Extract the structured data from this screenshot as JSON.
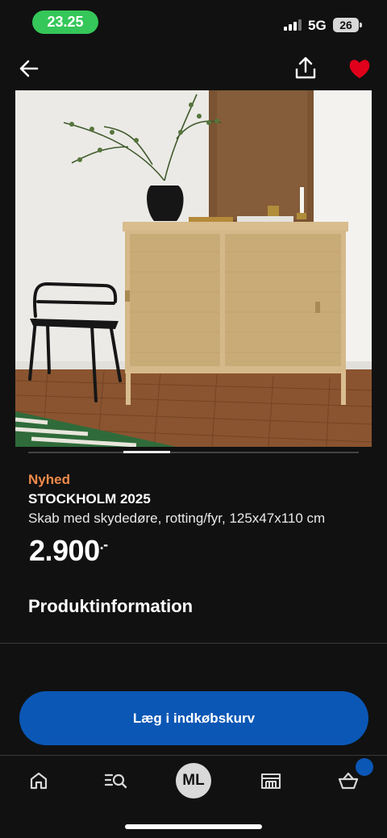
{
  "status_bar": {
    "time": "23.25",
    "network": "5G",
    "battery": "26"
  },
  "product": {
    "badge": "Nyhed",
    "name": "STOCKHOLM 2025",
    "description": "Skab med skydedøre, rotting/fyr, 125x47x110 cm",
    "price": "2.900",
    "price_suffix": ".-"
  },
  "carousel": {
    "active_index": 1
  },
  "section": {
    "title": "Produktinformation"
  },
  "cta": {
    "label": "Læg i indkøbskurv"
  },
  "tabbar": {
    "items": [
      {
        "icon": "home-icon"
      },
      {
        "icon": "search-list-icon"
      },
      {
        "avatar": "ML"
      },
      {
        "icon": "store-icon"
      },
      {
        "icon": "basket-icon"
      }
    ]
  },
  "colors": {
    "accent": "#0b57b5",
    "badge": "#f08a4b",
    "time_pill": "#35c759",
    "favorite": "#e0001b",
    "background": "#111111"
  }
}
